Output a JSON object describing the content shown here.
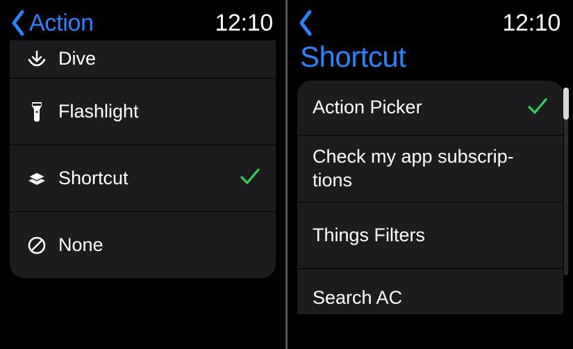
{
  "left": {
    "back_label": "Action",
    "time": "12:10",
    "rows": [
      {
        "icon": "dive",
        "label": "Dive",
        "selected": false
      },
      {
        "icon": "flashlight",
        "label": "Flashlight",
        "selected": false
      },
      {
        "icon": "shortcut",
        "label": "Shortcut",
        "selected": true
      },
      {
        "icon": "none",
        "label": "None",
        "selected": false
      }
    ]
  },
  "right": {
    "time": "12:10",
    "title": "Shortcut",
    "rows": [
      {
        "label": "Action Picker",
        "selected": true
      },
      {
        "label": "Check my app subscrip‐tions",
        "selected": false
      },
      {
        "label": "Things Filters",
        "selected": false
      },
      {
        "label": "Search AC",
        "selected": false
      }
    ]
  }
}
